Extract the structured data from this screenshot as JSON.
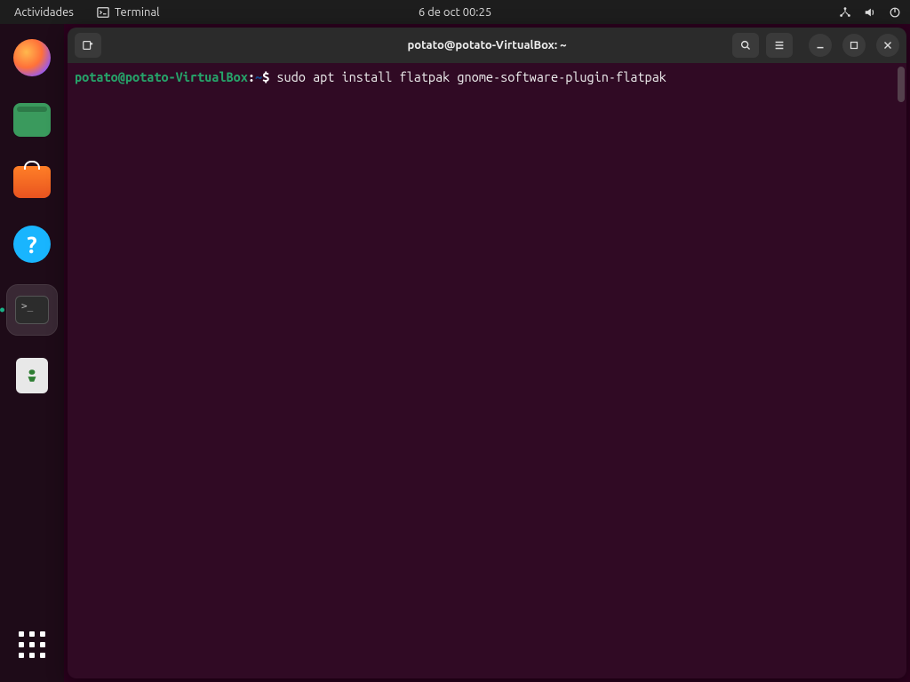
{
  "top_panel": {
    "activities_label": "Actividades",
    "app_label": "Terminal",
    "clock": "6 de oct  00:25"
  },
  "dock": {
    "items": [
      {
        "name": "firefox"
      },
      {
        "name": "files"
      },
      {
        "name": "software"
      },
      {
        "name": "help"
      },
      {
        "name": "terminal",
        "active": true
      },
      {
        "name": "trash"
      }
    ]
  },
  "window": {
    "title": "potato@potato-VirtualBox: ~"
  },
  "terminal": {
    "prompt_user": "potato@potato-VirtualBox",
    "prompt_sep1": ":",
    "prompt_path": "~",
    "prompt_sep2": "$ ",
    "command": "sudo apt install flatpak gnome-software-plugin-flatpak"
  }
}
